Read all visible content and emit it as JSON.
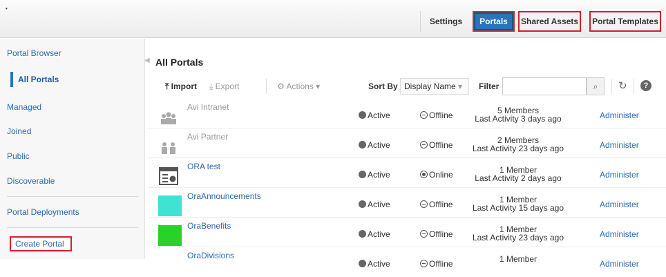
{
  "topbar": {
    "tabs": [
      "Settings",
      "Portals",
      "Shared Assets",
      "Portal Templates"
    ]
  },
  "sidebar": {
    "items": [
      "Portal Browser",
      "All Portals",
      "Managed",
      "Joined",
      "Public",
      "Discoverable",
      "Portal Deployments"
    ],
    "selected": "All Portals",
    "create_label": "Create Portal"
  },
  "main": {
    "title": "All Portals",
    "toolbar": {
      "import": "Import",
      "export": "Export",
      "actions": "Actions",
      "sort_by": "Sort By",
      "sort_value": "Display Name",
      "filter": "Filter",
      "filter_value": ""
    },
    "rows": [
      {
        "name": "Avi Intranet",
        "status": "Active",
        "online": "Offline",
        "members": "5 Members",
        "activity": "Last Activity 3 days ago",
        "admin": "Administer"
      },
      {
        "name": "Avi Partner",
        "status": "Active",
        "online": "Offline",
        "members": "2 Members",
        "activity": "Last Activity 23 days ago",
        "admin": "Administer"
      },
      {
        "name": "ORA test",
        "status": "Active",
        "online": "Online",
        "members": "1 Member",
        "activity": "Last Activity 2 days ago",
        "admin": "Administer"
      },
      {
        "name": "OraAnnouncements",
        "status": "Active",
        "online": "Offline",
        "members": "1 Member",
        "activity": "Last Activity 15 days ago",
        "admin": "Administer"
      },
      {
        "name": "OraBenefits",
        "status": "Active",
        "online": "Offline",
        "members": "1 Member",
        "activity": "Last Activity 23 days ago",
        "admin": "Administer"
      },
      {
        "name": "OraDivisions",
        "status": "Active",
        "online": "Offline",
        "members": "1 Member",
        "activity": "",
        "admin": "Administer"
      }
    ]
  },
  "colors": {
    "accent": "#2b73bd",
    "link": "#2a6bb1",
    "highlight": "#d61c2c",
    "thumb_teal": "#3fe3d4",
    "thumb_green": "#2bd12b"
  }
}
